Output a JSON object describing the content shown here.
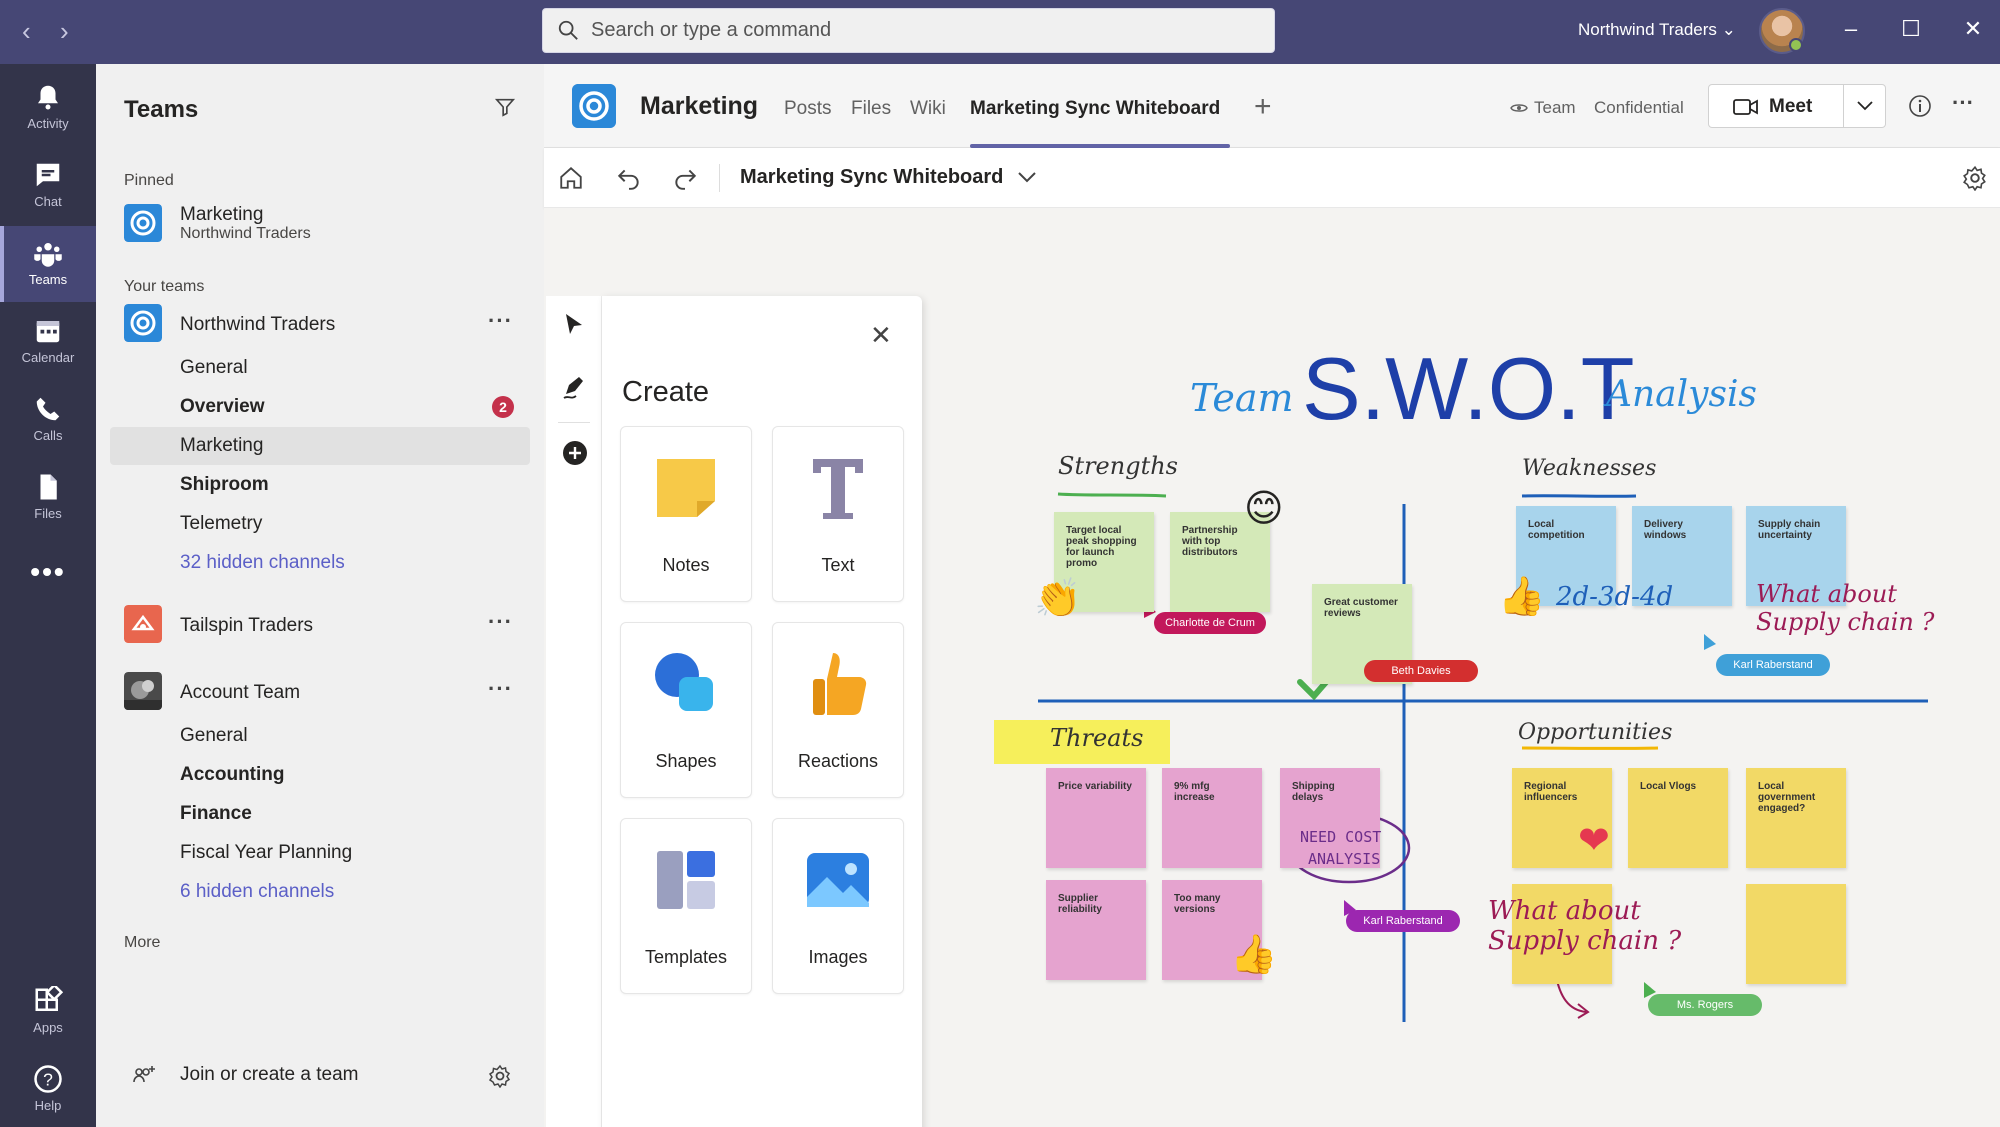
{
  "search": {
    "placeholder": "Search or type a command"
  },
  "org": {
    "name": "Northwind Traders ⌄"
  },
  "rail": [
    {
      "label": "Activity"
    },
    {
      "label": "Chat"
    },
    {
      "label": "Teams"
    },
    {
      "label": "Calendar"
    },
    {
      "label": "Calls"
    },
    {
      "label": "Files"
    },
    {
      "label": "Apps"
    },
    {
      "label": "Help"
    }
  ],
  "teams_panel": {
    "title": "Teams",
    "pinned_label": "Pinned",
    "pinned": {
      "name": "Marketing",
      "sub": "Northwind Traders"
    },
    "your_teams_label": "Your teams",
    "northwind": {
      "name": "Northwind Traders",
      "channels": [
        "General",
        "Overview",
        "Marketing",
        "Shiproom",
        "Telemetry"
      ],
      "overview_badge": "2",
      "hidden": "32 hidden channels"
    },
    "tailspin": {
      "name": "Tailspin Traders"
    },
    "account": {
      "name": "Account Team",
      "channels": [
        "General",
        "Accounting",
        "Finance",
        "Fiscal Year Planning"
      ],
      "hidden": "6 hidden channels"
    },
    "more_label": "More",
    "join_label": "Join or create a team"
  },
  "channel_header": {
    "title": "Marketing",
    "tabs": [
      "Posts",
      "Files",
      "Wiki",
      "Marketing Sync Whiteboard"
    ],
    "team_label": "Team",
    "confidential_label": "Confidential",
    "meet_label": "Meet"
  },
  "whiteboard": {
    "title": "Marketing Sync Whiteboard"
  },
  "create_panel": {
    "title": "Create",
    "tiles": [
      "Notes",
      "Text",
      "Shapes",
      "Reactions",
      "Templates",
      "Images"
    ]
  },
  "swot": {
    "team": "Team",
    "title": "S.W.O.T",
    "analysis": "Analysis",
    "strengths": "Strengths",
    "weaknesses": "Weaknesses",
    "threats": "Threats",
    "opportunities": "Opportunities",
    "strength_notes": [
      "Target local peak shopping for launch promo",
      "Partnership with top distributors",
      "Great customer reviews"
    ],
    "weakness_notes": [
      "Local competition",
      "Delivery windows",
      "Supply chain uncertainty"
    ],
    "threat_notes": [
      "Price variability",
      "9% mfg increase",
      "Shipping delays",
      "Supplier reliability",
      "Too many versions"
    ],
    "opportunity_notes": [
      "Regional influencers",
      "Local Vlogs",
      "Local government engaged?"
    ],
    "date_scribble": "2d-3d-4d",
    "supply_chain_1": "What about Supply chain ?",
    "supply_chain_2": "What about Supply chain ?",
    "need_cost_1": "NEED COST",
    "need_cost_2": "ANALYSIS",
    "cursors": [
      "Charlotte de Crum",
      "Beth Davies",
      "Karl Raberstand",
      "Karl Raberstand",
      "Ms. Rogers"
    ]
  },
  "colors": {
    "titlebar": "#464775",
    "rail": "#33344a",
    "accent": "#6264a7",
    "ink_blue": "#1e5fb8",
    "ink_magenta": "#9c1b55"
  }
}
